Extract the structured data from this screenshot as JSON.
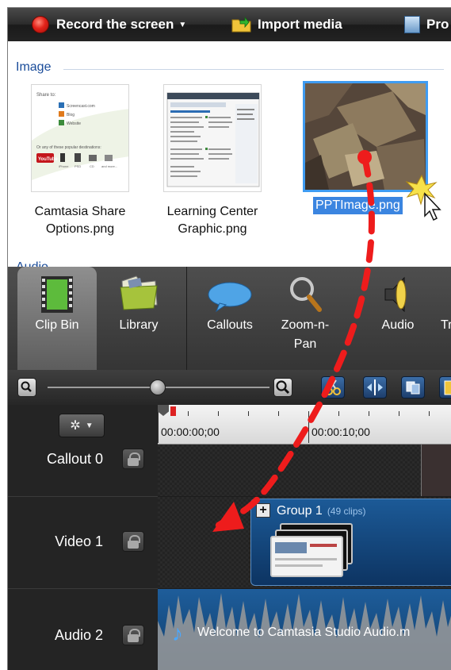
{
  "toolbar": {
    "record_label": "Record the screen",
    "import_label": "Import media",
    "produce_label": "Pro"
  },
  "media": {
    "image_section": "Image",
    "audio_section": "Audio",
    "thumbs": [
      {
        "name_line1": "Camtasia Share",
        "name_line2": "Options.png"
      },
      {
        "name_line1": "Learning Center",
        "name_line2": "Graphic.png"
      },
      {
        "name": "PPTImage.png"
      }
    ],
    "share_preview": {
      "share_to": "Share to:",
      "links": [
        "Screencast.com",
        "Blog",
        "Website"
      ],
      "other": "Or any of these popular destinations:",
      "destinations": [
        "YouTube",
        "iPhone",
        "PSD",
        "CD",
        "and more..."
      ]
    }
  },
  "tabs": [
    {
      "label": "Clip Bin"
    },
    {
      "label": "Library"
    },
    {
      "label": "Callouts"
    },
    {
      "label": "Zoom-n-Pan"
    },
    {
      "label": "Audio"
    },
    {
      "label": "Tr"
    }
  ],
  "timeline": {
    "timecodes": [
      "00:00:00;00",
      "00:00:10;00"
    ],
    "tracks": [
      {
        "name": "Callout 0"
      },
      {
        "name": "Video 1"
      },
      {
        "name": "Audio 2"
      }
    ],
    "group": {
      "title": "Group 1",
      "count": "(49 clips)"
    },
    "audio_clip": "Welcome to Camtasia Studio Audio.m"
  },
  "colors": {
    "selection": "#3f9cf2",
    "drag_arrow": "#ee1c1c",
    "clip_blue": "#1c5a97",
    "section_text": "#1a4c9a"
  },
  "icons": [
    "record-icon",
    "folder-import-icon",
    "produce-icon",
    "film-icon",
    "library-folder-icon",
    "callout-bubble-icon",
    "magnifier-icon",
    "speaker-icon",
    "zoom-out-icon",
    "zoom-in-icon",
    "cut-icon",
    "split-icon",
    "copy-icon",
    "gear-icon",
    "lock-icon",
    "music-note-icon",
    "cursor-icon"
  ]
}
